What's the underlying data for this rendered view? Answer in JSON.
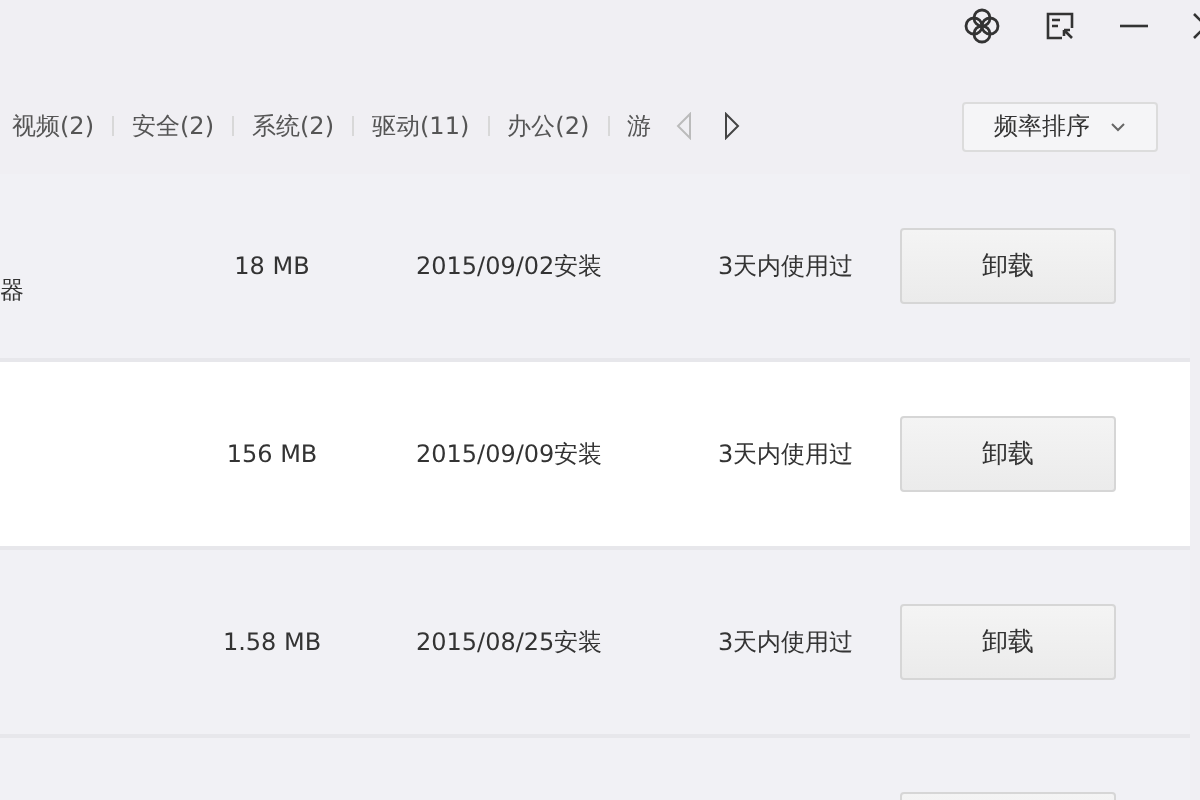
{
  "categories": [
    {
      "label": "视频(2)",
      "selected": false
    },
    {
      "label": "安全(2)",
      "selected": false
    },
    {
      "label": "系统(2)",
      "selected": false
    },
    {
      "label": "驱动(11)",
      "selected": false
    },
    {
      "label": "办公(2)",
      "selected": false
    },
    {
      "label": "游",
      "selected": false
    }
  ],
  "sort": {
    "label": "频率排序"
  },
  "rows": [
    {
      "name": "器",
      "size": "18 MB",
      "installed": "2015/09/02安装",
      "last_used": "3天内使用过",
      "action": "卸载",
      "highlighted": false
    },
    {
      "size": "156 MB",
      "installed": "2015/09/09安装",
      "last_used": "3天内使用过",
      "action": "卸载",
      "highlighted": true
    },
    {
      "size": "1.58 MB",
      "installed": "2015/08/25安装",
      "last_used": "3天内使用过",
      "action": "卸载",
      "highlighted": false
    },
    {
      "highlighted": false
    }
  ]
}
